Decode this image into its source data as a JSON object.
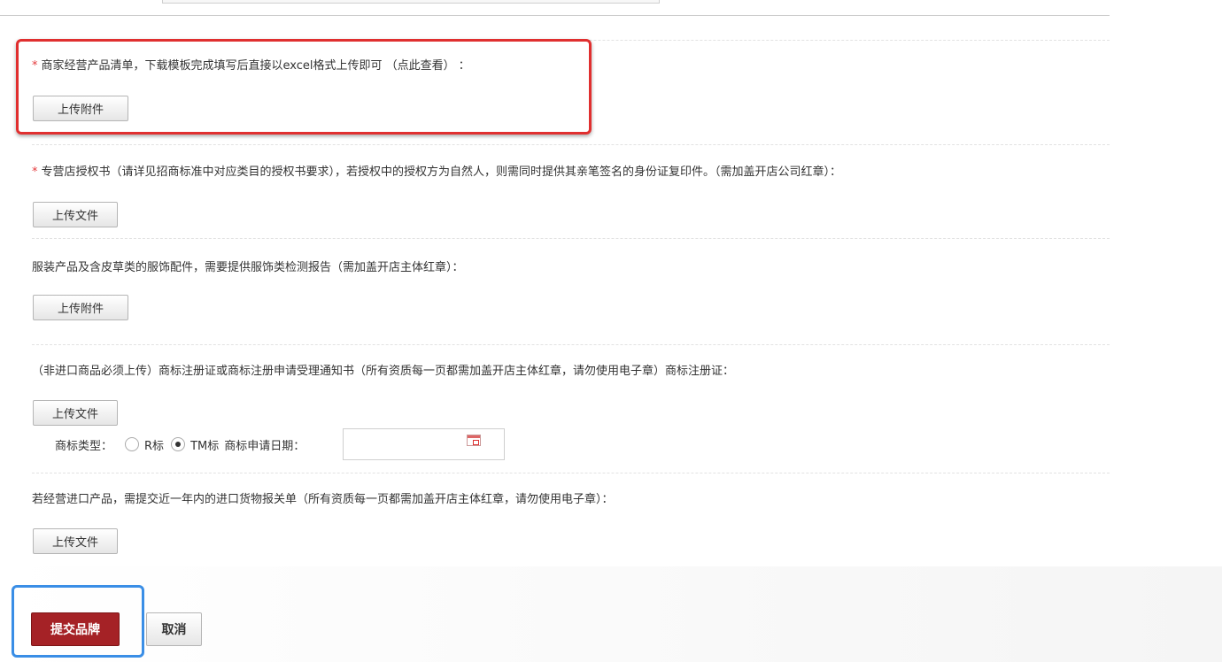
{
  "sections": [
    {
      "required": true,
      "label": "商家经营产品清单，下载模板完成填写后直接以excel格式上传即可",
      "link": "（点此查看）",
      "suffix": "：",
      "button": "上传附件"
    },
    {
      "required": true,
      "label": "专营店授权书（请详见招商标准中对应类目的授权书要求），若授权中的授权方为自然人，则需同时提供其亲笔签名的身份证复印件。（需加盖开店公司红章）：",
      "button": "上传文件"
    },
    {
      "required": false,
      "label": "服装产品及含皮草类的服饰配件，需要提供服饰类检测报告（需加盖开店主体红章）：",
      "button": "上传附件"
    },
    {
      "required": false,
      "label": "（非进口商品必须上传）商标注册证或商标注册申请受理通知书（所有资质每一页都需加盖开店主体红章，请勿使用电子章）商标注册证：",
      "button": "上传文件"
    },
    {
      "required": false,
      "label": "若经营进口产品，需提交近一年内的进口货物报关单（所有资质每一页都需加盖开店主体红章，请勿使用电子章）：",
      "button": "上传文件"
    }
  ],
  "required_mark": "*",
  "trademark": {
    "type_label": "商标类型：",
    "option_r": "R标",
    "option_tm": "TM标",
    "selected": "TM标",
    "date_label": "商标申请日期：",
    "date_value": "",
    "calendar_icon": "calendar-icon"
  },
  "actions": {
    "submit": "提交品牌",
    "cancel": "取消"
  },
  "colors": {
    "required_mark": "#e4393c",
    "submit_bg": "#a52226",
    "highlight_red": "#e02f2f",
    "highlight_blue": "#3a8ee6"
  }
}
